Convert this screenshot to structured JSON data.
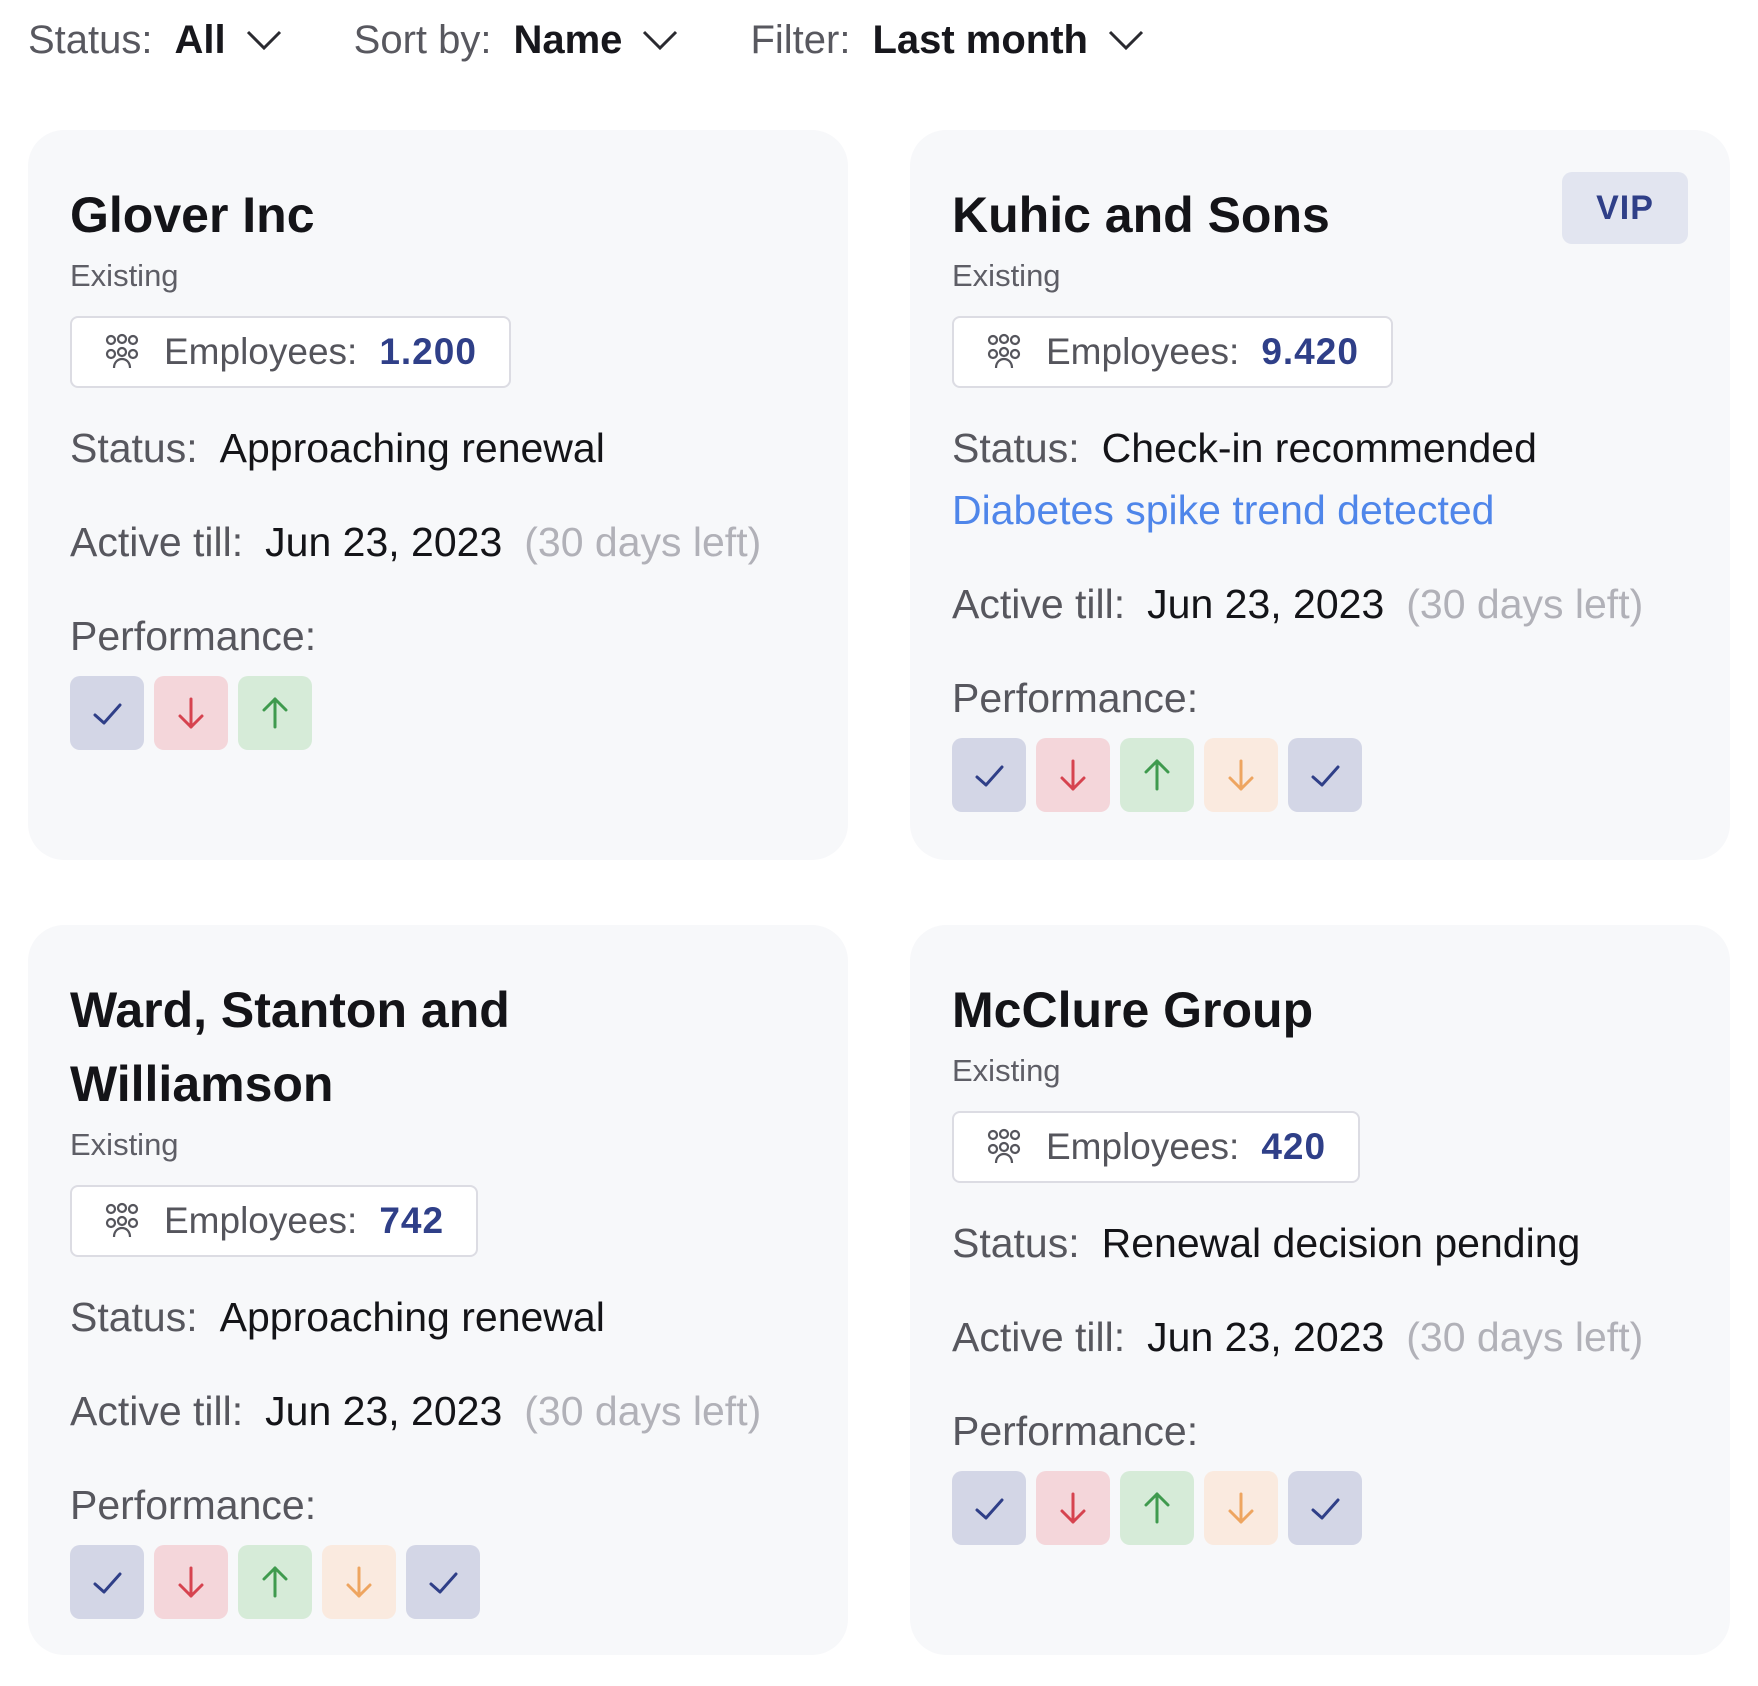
{
  "filters": [
    {
      "label": "Status:",
      "value": "All"
    },
    {
      "label": "Sort by:",
      "value": "Name"
    },
    {
      "label": "Filter:",
      "value": "Last month"
    }
  ],
  "labels": {
    "employees": "Employees:",
    "status": "Status:",
    "active_till": "Active till:",
    "performance": "Performance:"
  },
  "performance_styles": {
    "check": {
      "icon": "check-icon",
      "bg": "#d3d6e6",
      "fg": "#2f3f88"
    },
    "down": {
      "icon": "arrow-down-icon",
      "bg": "#f4d6da",
      "fg": "#d6434f"
    },
    "up": {
      "icon": "arrow-up-icon",
      "bg": "#d6ebd8",
      "fg": "#3f9a4e"
    },
    "down-warning": {
      "icon": "arrow-down-icon",
      "bg": "#faeadf",
      "fg": "#eea560"
    }
  },
  "cards": [
    {
      "name": "Glover Inc",
      "type": "Existing",
      "employees": "1.200",
      "status": "Approaching renewal",
      "active_till": "Jun 23, 2023",
      "days_left": "(30 days left)",
      "performance": [
        "check",
        "down",
        "up"
      ]
    },
    {
      "name": "Kuhic and Sons",
      "badge": "VIP",
      "type": "Existing",
      "employees": "9.420",
      "status": "Check-in recommended",
      "alert": "Diabetes spike trend detected",
      "active_till": "Jun 23, 2023",
      "days_left": "(30 days left)",
      "performance": [
        "check",
        "down",
        "up",
        "down-warning",
        "check"
      ]
    },
    {
      "name": "Ward, Stanton and Williamson",
      "type": "Existing",
      "employees": "742",
      "status": "Approaching renewal",
      "active_till": "Jun 23, 2023",
      "days_left": "(30 days left)",
      "performance": [
        "check",
        "down",
        "up",
        "down-warning",
        "check"
      ]
    },
    {
      "name": "McClure Group",
      "type": "Existing",
      "employees": "420",
      "status": "Renewal decision pending",
      "active_till": "Jun 23, 2023",
      "days_left": "(30 days left)",
      "performance": [
        "check",
        "down",
        "up",
        "down-warning",
        "check"
      ]
    }
  ]
}
